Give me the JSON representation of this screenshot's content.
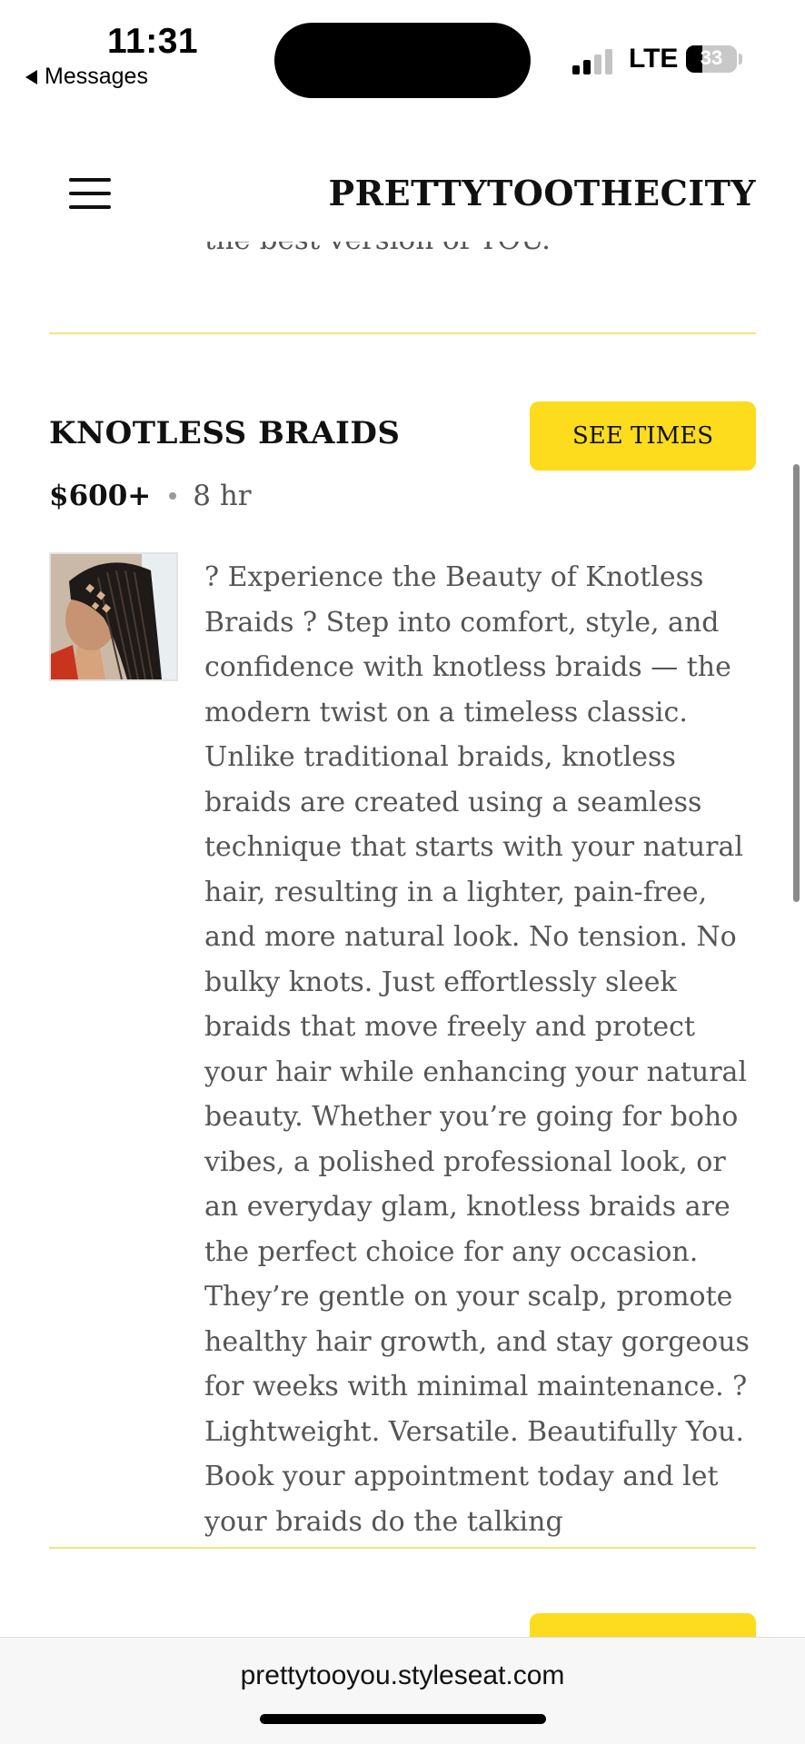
{
  "status_bar": {
    "time": "11:31",
    "back_label": "Messages",
    "network": "LTE",
    "battery_level": "33",
    "battery_fraction": 0.33
  },
  "header": {
    "brand": "PRETTYTOOTHECITY",
    "menu_icon": "hamburger-menu-icon"
  },
  "previous_section": {
    "partial_text": "the best version of YOU."
  },
  "service": {
    "title": "KNOTLESS BRAIDS",
    "button_label": "SEE TIMES",
    "price": "$600+",
    "duration": "8 hr",
    "description": "? Experience the Beauty of Knotless Braids ? Step into comfort, style, and confidence with knotless braids — the modern twist on a timeless classic. Unlike traditional braids, knotless braids are created using a seamless technique that starts with your natural hair, resulting in a lighter, pain-free, and more natural look. No tension. No bulky knots. Just effortlessly sleek braids that move freely and protect your hair while enhancing your natural beauty. Whether you’re going for boho vibes, a polished professional look, or an everyday glam, knotless braids are the perfect choice for any occasion. They’re gentle on your scalp, promote healthy hair growth, and stay gorgeous for weeks with minimal maintenance. ? Lightweight. Versatile. Beautifully You. Book your appointment today and let your braids do the talking"
  },
  "browser": {
    "url": "prettytooyou.styleseat.com"
  },
  "colors": {
    "accent_yellow": "#fddb1d",
    "divider_yellow": "#f6e37a",
    "body_text": "#555555"
  }
}
